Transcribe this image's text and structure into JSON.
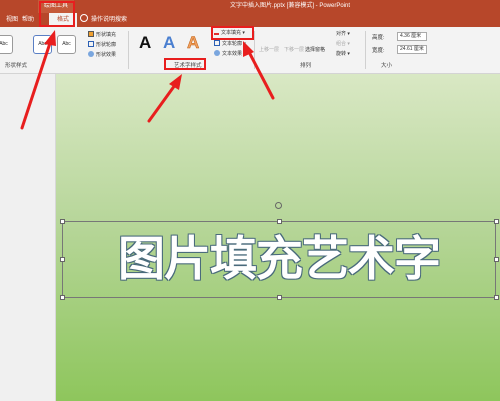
{
  "title_bar": {
    "context_tab_group": "绘图工具",
    "window_title": "文字中插入图片.pptx [兼容模式] - PowerPoint"
  },
  "tabs": [
    {
      "label": "视图",
      "active": false
    },
    {
      "label": "帮助",
      "active": false
    },
    {
      "label": "格式",
      "active": true
    },
    {
      "label": "操作说明搜索",
      "active": false
    }
  ],
  "ribbon": {
    "shape_styles": {
      "thumbs": [
        "Abc",
        "Abc",
        "Abc"
      ],
      "fill": "形状填充",
      "outline": "形状轮廓",
      "effects": "形状效果",
      "group_label": "形状样式"
    },
    "wordart_styles": {
      "letters": [
        "A",
        "A",
        "A"
      ],
      "text_fill": "文本填充",
      "text_outline": "文本轮廓",
      "text_effects": "文本效果",
      "group_label": "艺术字样式"
    },
    "arrange": {
      "bring_forward": "上移一层",
      "send_backward": "下移一层",
      "selection_pane": "选择窗格",
      "align": "对齐",
      "group": "组合",
      "rotate": "旋转",
      "group_label": "排列"
    },
    "size": {
      "height_label": "高度:",
      "height_value": "4.36 厘米",
      "width_label": "宽度:",
      "width_value": "24.61 厘米",
      "group_label": "大小"
    }
  },
  "slide": {
    "wordart_text": "图片填充艺术字"
  },
  "colors": {
    "accent": "#b7472a",
    "highlight_box": "#e81e1e",
    "slide_top": "#d9e8c4",
    "slide_bottom": "#8ec65c"
  }
}
